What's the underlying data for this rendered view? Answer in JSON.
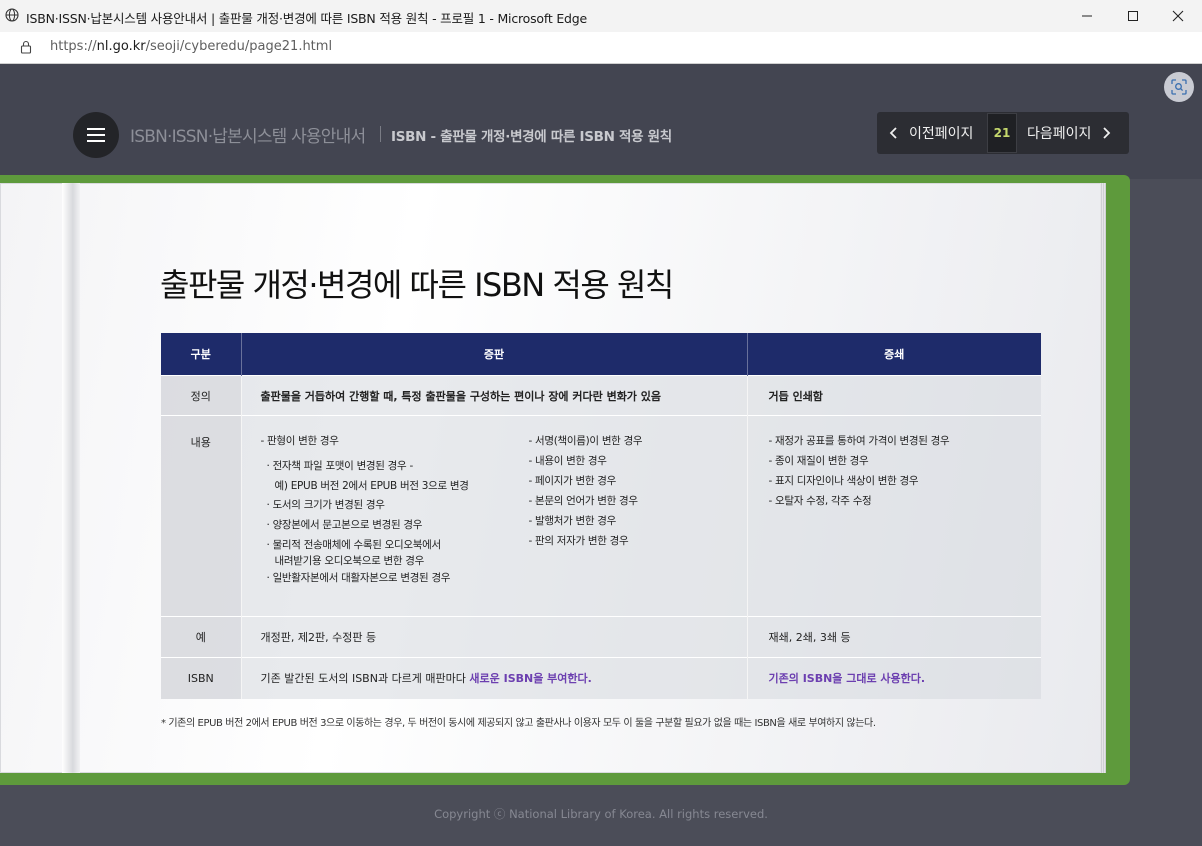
{
  "window": {
    "title": "ISBN·ISSN·납본시스템 사용안내서 | 출판물 개정·변경에 따른 ISBN 적용 원칙 - 프로필 1 - Microsoft Edge",
    "url_prefix": "https://",
    "url_domain": "nl.go.kr",
    "url_path": "/seoji/cyberedu/page21.html"
  },
  "header": {
    "site_title": "ISBN·ISSN·납본시스템 사용안내서",
    "page_subtitle": "ISBN - 출판물 개정·변경에 따른 ISBN 적용 원칙",
    "prev_label": "이전페이지",
    "page_number": "21",
    "next_label": "다음페이지"
  },
  "doc": {
    "heading": "출판물 개정·변경에 따른 ISBN 적용 원칙",
    "table": {
      "headers": [
        "구분",
        "증판",
        "증쇄"
      ],
      "rows": {
        "definition": {
          "category": "정의",
          "revision": "출판물을 거듭하여 간행할 때, 특정 출판물을 구성하는 편이나 장에 커다란 변화가 있음",
          "reprint": "거듭 인쇄함"
        },
        "content": {
          "category": "내용",
          "revision_left": [
            "- 판형이 변한 경우",
            "· 전자책 파일 포맷이 변경된 경우 -",
            "  예) EPUB 버전 2에서 EPUB 버전 3으로 변경",
            "· 도서의 크기가 변경된 경우",
            "· 양장본에서 문고본으로 변경된 경우",
            "· 물리적 전송매체에 수록된 오디오북에서",
            "  내려받기용 오디오북으로 변한 경우",
            "· 일반활자본에서 대활자본으로 변경된 경우"
          ],
          "revision_right": [
            "- 서명(책이름)이 변한 경우",
            "- 내용이 변한 경우",
            "- 페이지가 변한 경우",
            "- 본문의 언어가 변한 경우",
            "- 발행처가 변한 경우",
            "- 판의 저자가 변한 경우"
          ],
          "reprint": [
            "- 재정가 공표를 통하여 가격이 변경된 경우",
            "- 종이 재질이 변한 경우",
            "- 표지 디자인이나 색상이 변한 경우",
            "- 오탈자 수정, 각주 수정"
          ]
        },
        "example": {
          "category": "예",
          "revision": "개정판, 제2판, 수정판 등",
          "reprint": "재쇄, 2쇄, 3쇄 등"
        },
        "isbn": {
          "category": "ISBN",
          "revision_prefix": "기존 발간된 도서의 ISBN과 다르게 매판마다 ",
          "revision_emphasis": "새로운 ISBN을 부여한다.",
          "reprint_emphasis": "기존의 ISBN을 그대로 사용한다."
        }
      }
    },
    "footnote": "* 기존의 EPUB 버전 2에서 EPUB 버전 3으로 이동하는 경우, 두 버전이 동시에 제공되지 않고 출판사나 이용자 모두 이 둘을 구분할 필요가 없을 때는 ISBN을 새로 부여하지 않는다."
  },
  "footer": {
    "copyright": "Copyright ⓒ National Library of Korea. All rights reserved."
  },
  "colors": {
    "table_header": "#1e2b6a",
    "emphasis": "#6c3fb0",
    "page_number": "#c5d86d",
    "book_cover": "#5e9a3c"
  }
}
